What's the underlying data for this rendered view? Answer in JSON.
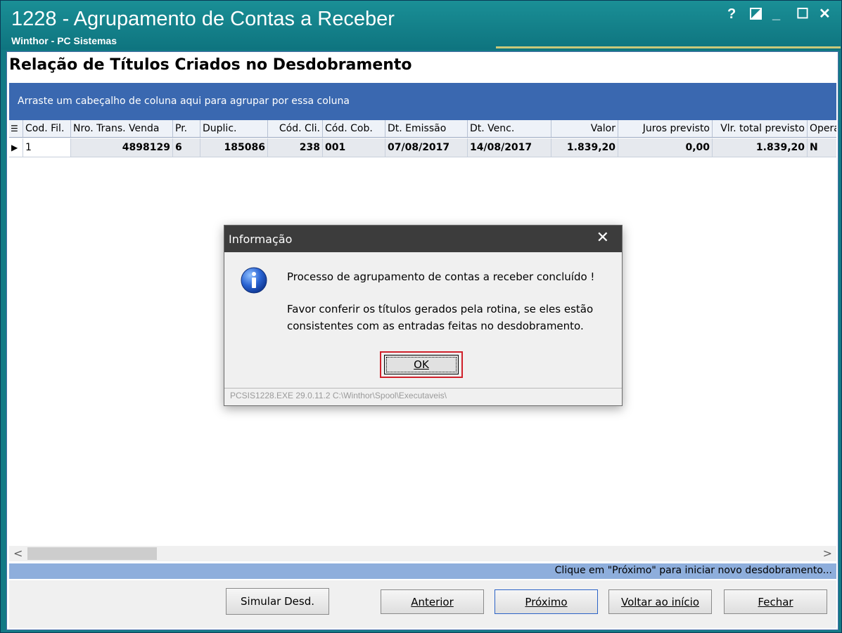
{
  "window": {
    "title": "1228 - Agrupamento de Contas a Receber",
    "subtitle": "Winthor - PC Sistemas",
    "help": "?",
    "minimize": "_",
    "maximize": "☐",
    "close": "✕"
  },
  "panel": {
    "heading": "Relação de Títulos Criados no Desdobramento",
    "group_hint": "Arraste um cabeçalho de coluna aqui para agrupar por essa coluna"
  },
  "grid": {
    "columns": [
      "Cod. Fil.",
      "Nro. Trans. Venda",
      "Pr.",
      "Duplic.",
      "Cód. Cli.",
      "Cód. Cob.",
      "Dt. Emissão",
      "Dt. Venc.",
      "Valor",
      "Juros previsto",
      "Vlr. total previsto",
      "Opera"
    ],
    "rows": [
      [
        "1",
        "4898129",
        "6",
        "185086",
        "238",
        "001",
        "07/08/2017",
        "14/08/2017",
        "1.839,20",
        "0,00",
        "1.839,20",
        "N"
      ]
    ]
  },
  "status_text": "Clique em \"Próximo\" para iniciar novo desdobramento...",
  "buttons": {
    "simular": "Simular Desd.",
    "anterior": "Anterior",
    "proximo": "Próximo",
    "voltar": "Voltar ao início",
    "fechar": "Fechar"
  },
  "dialog": {
    "title": "Informação",
    "line1": "Processo de agrupamento de contas a receber concluído !",
    "line2": "Favor conferir os títulos gerados pela rotina, se eles estão",
    "line3": "consistentes com as entradas feitas no desdobramento.",
    "ok": "OK",
    "footer": "PCSIS1228.EXE 29.0.11.2 C:\\Winthor\\Spool\\Executaveis\\",
    "icon": "info-icon"
  },
  "colors": {
    "title_bar": "#137a85",
    "group_band": "#3a68b0",
    "status_band": "#8eaedc",
    "ok_highlight": "#d0202a"
  }
}
